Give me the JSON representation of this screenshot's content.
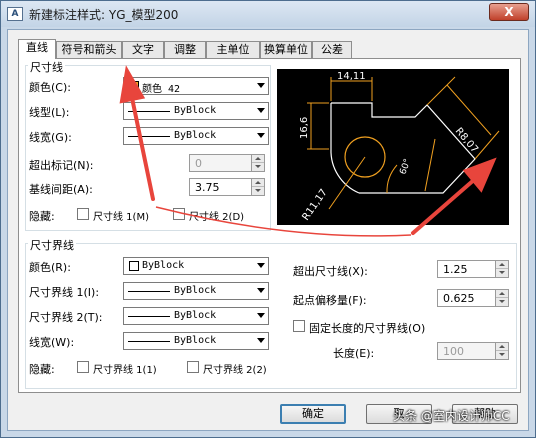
{
  "window": {
    "title": "新建标注样式: YG_模型200",
    "close_label": "X",
    "app_icon": "A"
  },
  "tabs": [
    "直线",
    "符号和箭头",
    "文字",
    "调整",
    "主单位",
    "换算单位",
    "公差"
  ],
  "dim_line": {
    "group_title": "尺寸线",
    "color_label": "颜色(C):",
    "color_value": "颜色 42",
    "color_swatch": "#f0a020",
    "linetype_label": "线型(L):",
    "linetype_value": "ByBlock",
    "lineweight_label": "线宽(G):",
    "lineweight_value": "ByBlock",
    "extend_label": "超出标记(N):",
    "extend_value": "0",
    "baseline_label": "基线间距(A):",
    "baseline_value": "3.75",
    "suppress_label": "隐藏:",
    "suppress1_label": "尺寸线 1(M)",
    "suppress2_label": "尺寸线 2(D)"
  },
  "ext_line": {
    "group_title": "尺寸界线",
    "color_label": "颜色(R):",
    "color_value": "ByBlock",
    "linetype1_label": "尺寸界线 1(I):",
    "linetype1_value": "ByBlock",
    "linetype2_label": "尺寸界线 2(T):",
    "linetype2_value": "ByBlock",
    "lineweight_label": "线宽(W):",
    "lineweight_value": "ByBlock",
    "suppress_label": "隐藏:",
    "suppress1_label": "尺寸界线 1(1)",
    "suppress2_label": "尺寸界线 2(2)",
    "beyond_label": "超出尺寸线(X):",
    "beyond_value": "1.25",
    "offset_label": "起点偏移量(F):",
    "offset_value": "0.625",
    "fixed_label": "固定长度的尺寸界线(O)",
    "length_label": "长度(E):",
    "length_value": "100"
  },
  "preview": {
    "dim_top": "14,11",
    "dim_left": "16,6",
    "dim_angle": "60°",
    "dim_right": "R8,07",
    "dim_radius": "R11,17"
  },
  "buttons": {
    "ok": "确定",
    "cancel": "取",
    "help": "帮助"
  },
  "watermark": "头条 @室内设计师CC",
  "colors": {
    "accent_arrow": "#e8453c",
    "preview_lines": "#ffffff",
    "preview_dims": "#f0a020"
  }
}
